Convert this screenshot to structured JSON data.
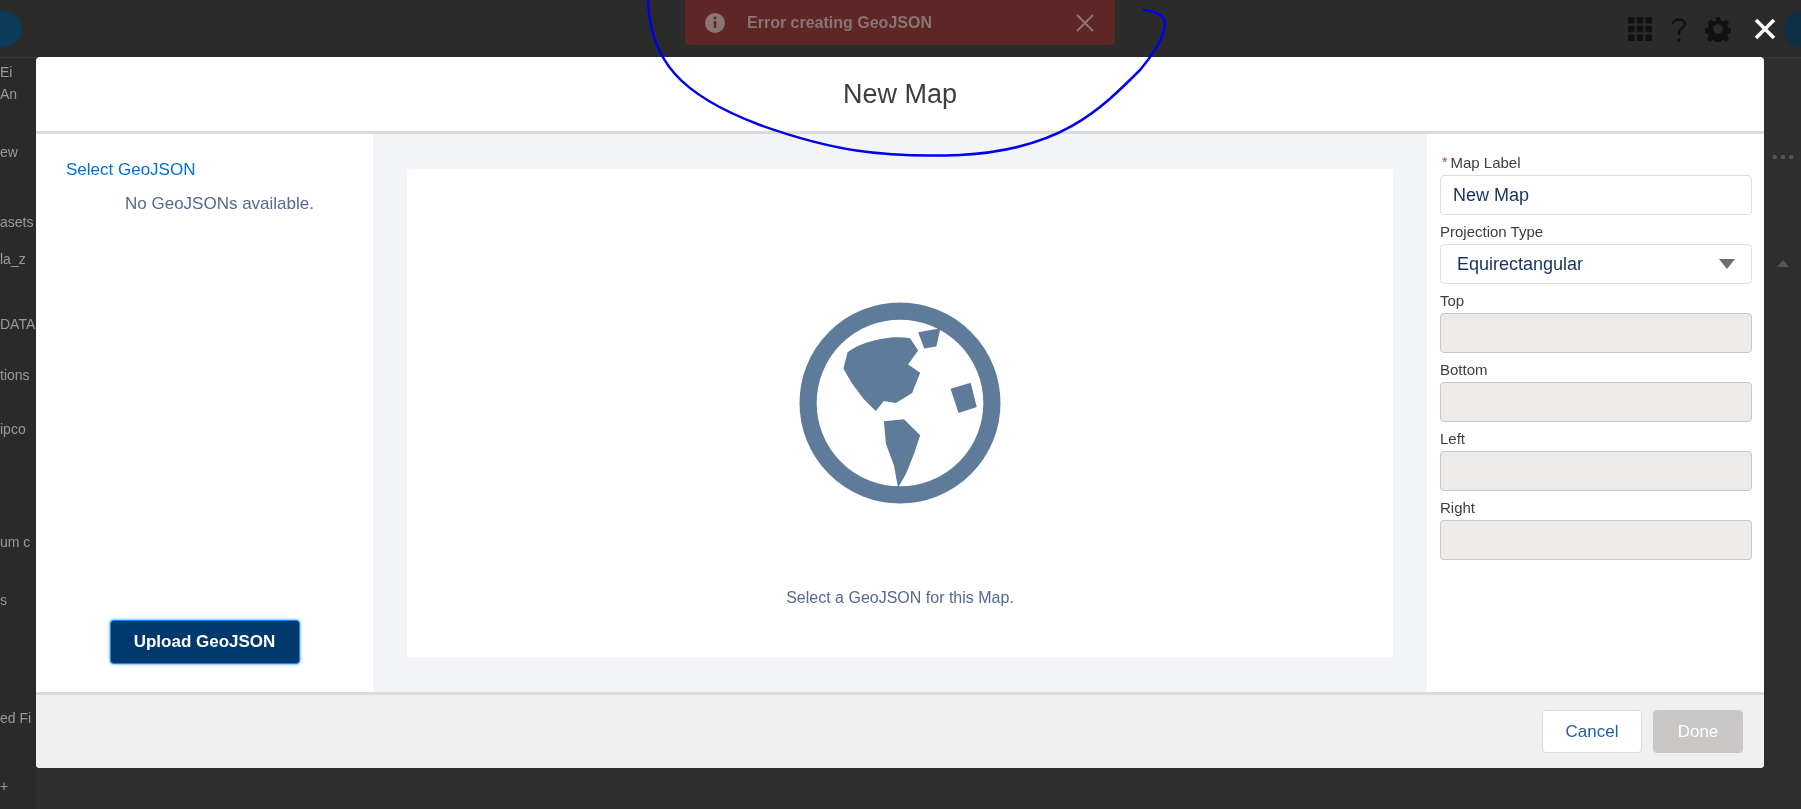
{
  "toast": {
    "message": "Error creating GeoJSON"
  },
  "background": {
    "fragments": [
      "Ei",
      "An",
      "ew",
      "asets",
      "la_z",
      "DATA",
      "tions",
      "ipco",
      "um c",
      "s",
      "ed Fi",
      "+"
    ]
  },
  "modal": {
    "title": "New Map",
    "left_panel": {
      "link": "Select GeoJSON",
      "empty_message": "No GeoJSONs available.",
      "upload_button": "Upload GeoJSON"
    },
    "preview": {
      "message": "Select a GeoJSON for this Map."
    },
    "form": {
      "fields": [
        {
          "label": "Map Label",
          "kind": "text",
          "required_mark": "*",
          "disabled": false,
          "value": "New Map"
        },
        {
          "label": "Projection Type",
          "kind": "select",
          "disabled": false,
          "value": "Equirectangular"
        },
        {
          "label": "Top",
          "kind": "text",
          "disabled": true
        },
        {
          "label": "Bottom",
          "kind": "text",
          "disabled": true
        },
        {
          "label": "Left",
          "kind": "text",
          "disabled": true
        },
        {
          "label": "Right",
          "kind": "text",
          "disabled": true
        }
      ]
    },
    "footer": {
      "buttons": [
        {
          "label": "Cancel",
          "disabled": false
        },
        {
          "label": "Done",
          "disabled": true
        }
      ]
    }
  }
}
